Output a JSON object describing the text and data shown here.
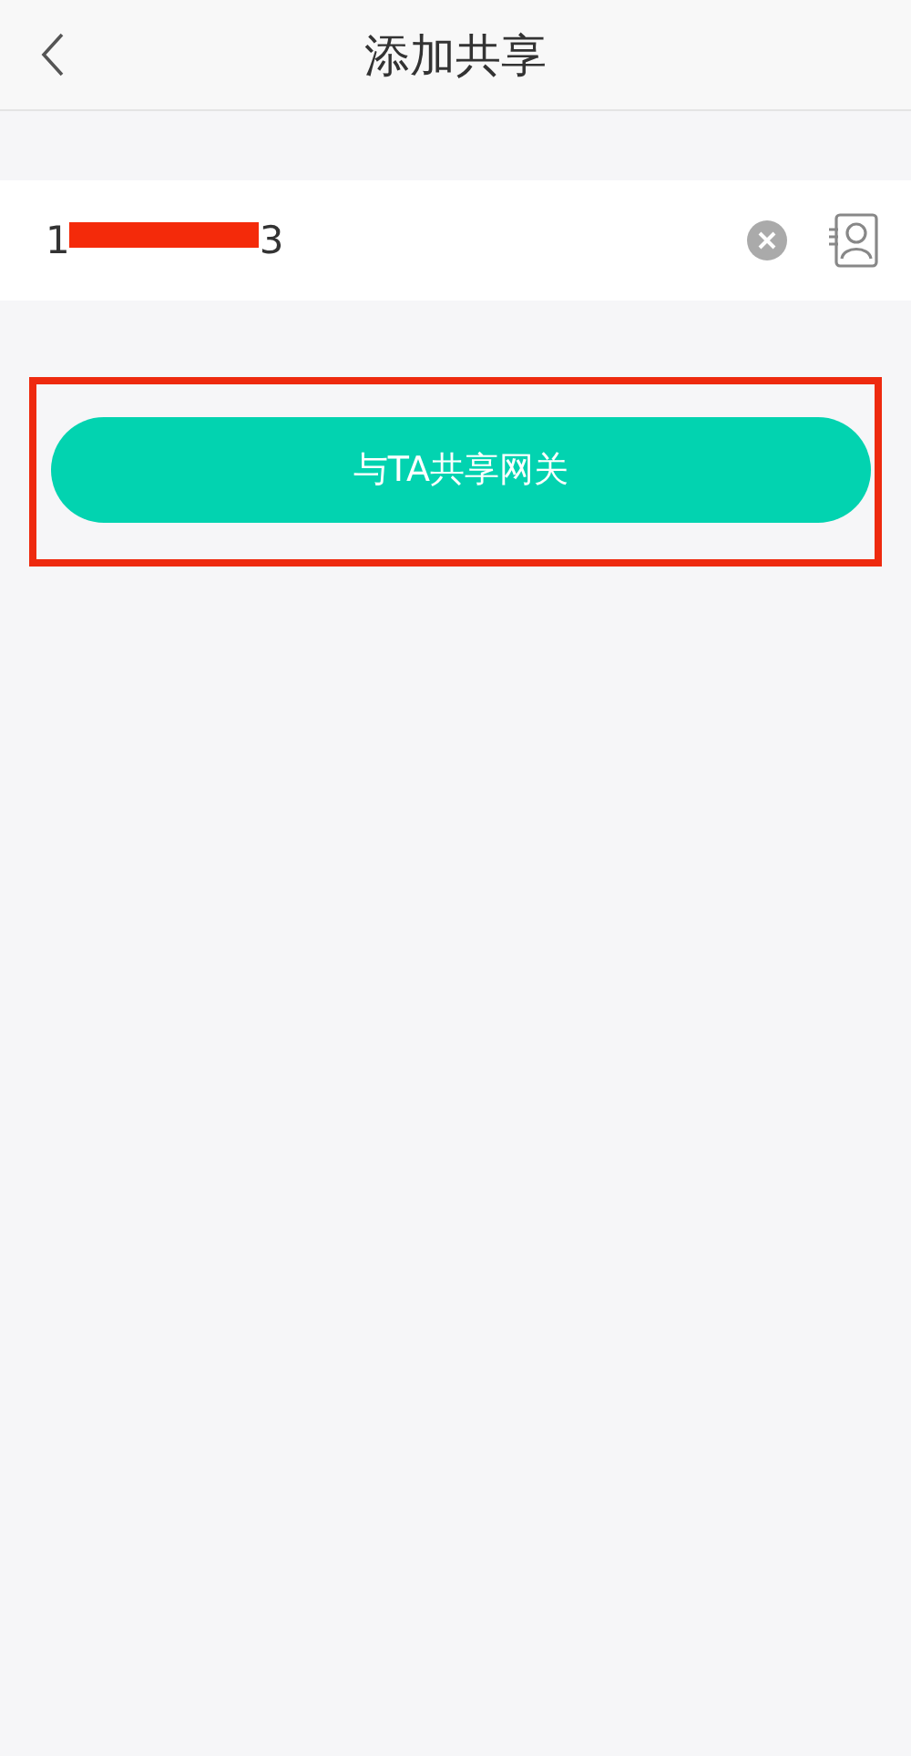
{
  "header": {
    "title": "添加共享"
  },
  "phone_field": {
    "value_start": "1",
    "value_end": "3",
    "redacted": true
  },
  "share_button": {
    "label": "与TA共享网关",
    "highlighted": true
  }
}
